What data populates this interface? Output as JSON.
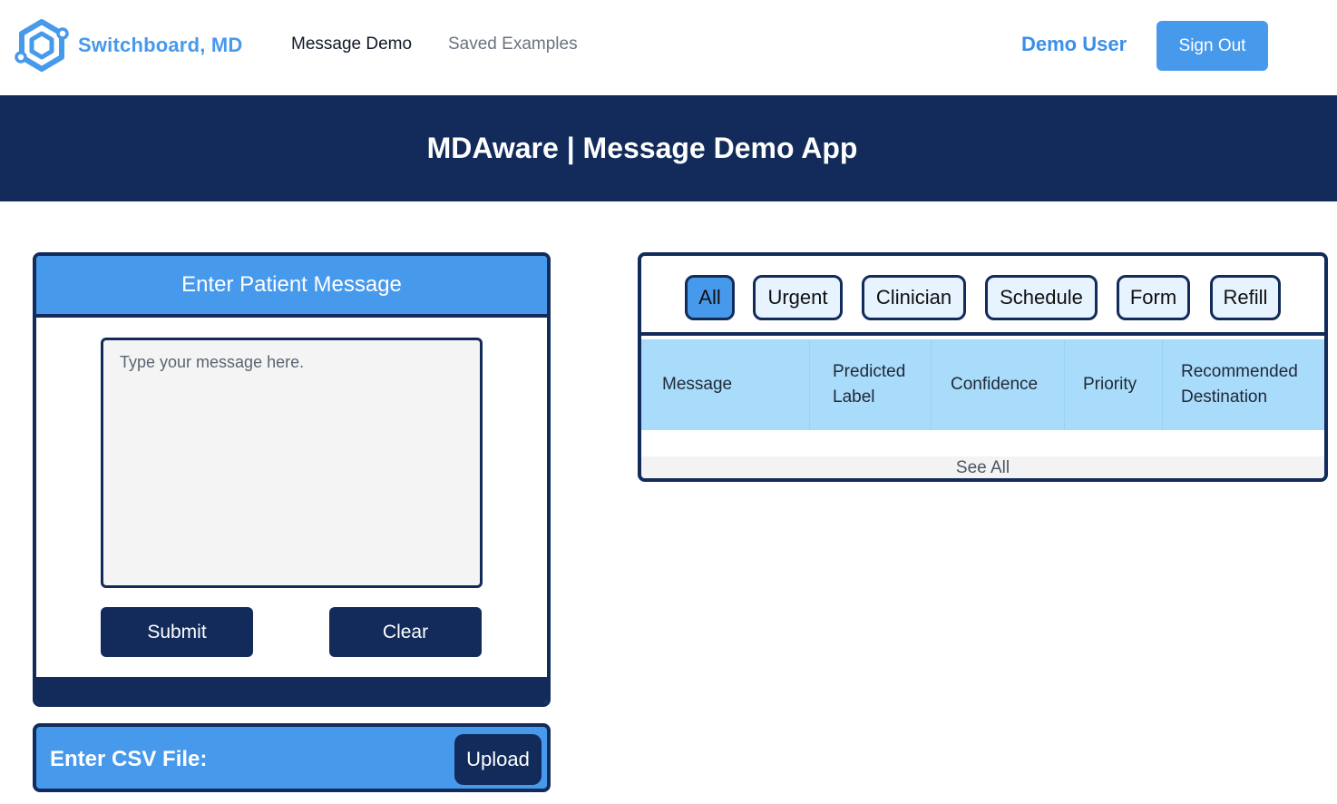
{
  "nav": {
    "brand": "Switchboard, MD",
    "links": [
      "Message Demo",
      "Saved Examples"
    ],
    "user": "Demo User",
    "signout": "Sign Out"
  },
  "banner": {
    "title": "MDAware | Message Demo App"
  },
  "message_card": {
    "title": "Enter Patient Message",
    "placeholder": "Type your message here.",
    "submit": "Submit",
    "clear": "Clear"
  },
  "csv": {
    "label": "Enter CSV File:",
    "upload": "Upload"
  },
  "filters": [
    "All",
    "Urgent",
    "Clinician",
    "Schedule",
    "Form",
    "Refill"
  ],
  "selected_filter": "All",
  "table": {
    "headers": [
      [
        "Message"
      ],
      [
        "Predicted",
        "Label"
      ],
      [
        "Confidence"
      ],
      [
        "Priority"
      ],
      [
        "Recommended",
        "Destination"
      ]
    ],
    "see_all": "See All"
  },
  "colors": {
    "navy": "#122b5a",
    "accent_blue": "#4799ec",
    "header_light_blue": "#a9dbfa",
    "filter_bg": "#e7f3fe"
  }
}
